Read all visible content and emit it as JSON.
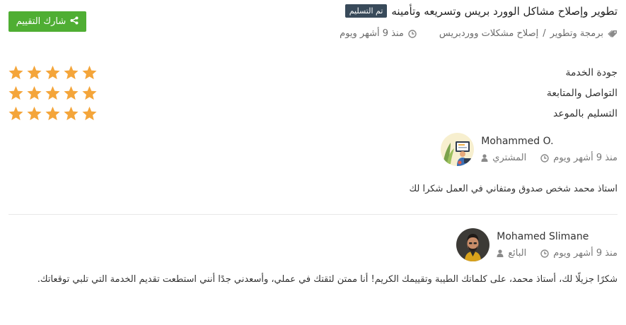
{
  "header": {
    "status_badge": "تم التسليم",
    "title": "تطوير وإصلاح مشاكل الوورد بريس وتسريعه وتأمينه",
    "category": "برمجة وتطوير",
    "separator": "/",
    "subcategory": "إصلاح مشكلات ووردبريس",
    "time": "منذ 9 أشهر ويوم",
    "share_button": "شارك التقييم",
    "accent_color": "#4fae33"
  },
  "ratings": [
    {
      "label": "جودة الخدمة",
      "stars": 5
    },
    {
      "label": "التواصل والمتابعة",
      "stars": 5
    },
    {
      "label": "التسليم بالموعد",
      "stars": 5
    }
  ],
  "buyer_review": {
    "name": "Mohammed O.",
    "role": "المشتري",
    "time": "منذ 9 أشهر ويوم",
    "text": "استاذ محمد شخص صدوق ومتفاني في العمل شكرا لك"
  },
  "seller_reply": {
    "name": "Mohamed Slimane",
    "role": "البائع",
    "time": "منذ 9 أشهر ويوم",
    "text": "شكرًا جزيلًا لك، أستاذ محمد، على كلماتك الطيبة وتقييمك الكريم! أنا ممتن لثقتك في عملي، وأسعدني جدًا أنني استطعت تقديم الخدمة التي تلبي توقعاتك."
  },
  "star_color": "#f4a53a"
}
